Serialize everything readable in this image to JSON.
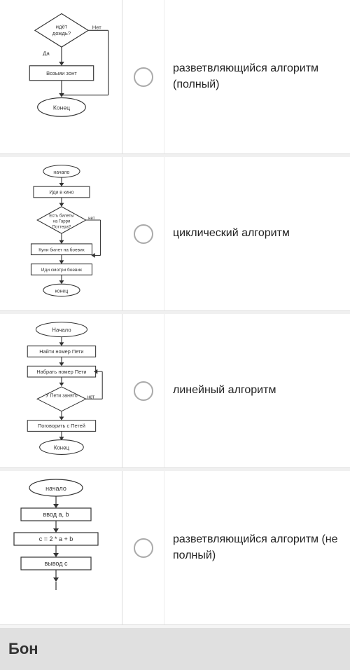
{
  "quiz": {
    "rows": [
      {
        "id": "row1",
        "answer_text": "разветвляющийся алгоритм (полный)",
        "flowchart_type": "branching_full",
        "selected": false
      },
      {
        "id": "row2",
        "answer_text": "циклический алгоритм",
        "flowchart_type": "cyclic",
        "selected": false
      },
      {
        "id": "row3",
        "answer_text": "линейный алгоритм",
        "flowchart_type": "linear",
        "selected": false
      },
      {
        "id": "row4",
        "answer_text": "разветвляющийся алгоритм (не полный)",
        "flowchart_type": "branching_partial",
        "selected": false
      }
    ]
  },
  "bottom": {
    "label": "Бон"
  }
}
